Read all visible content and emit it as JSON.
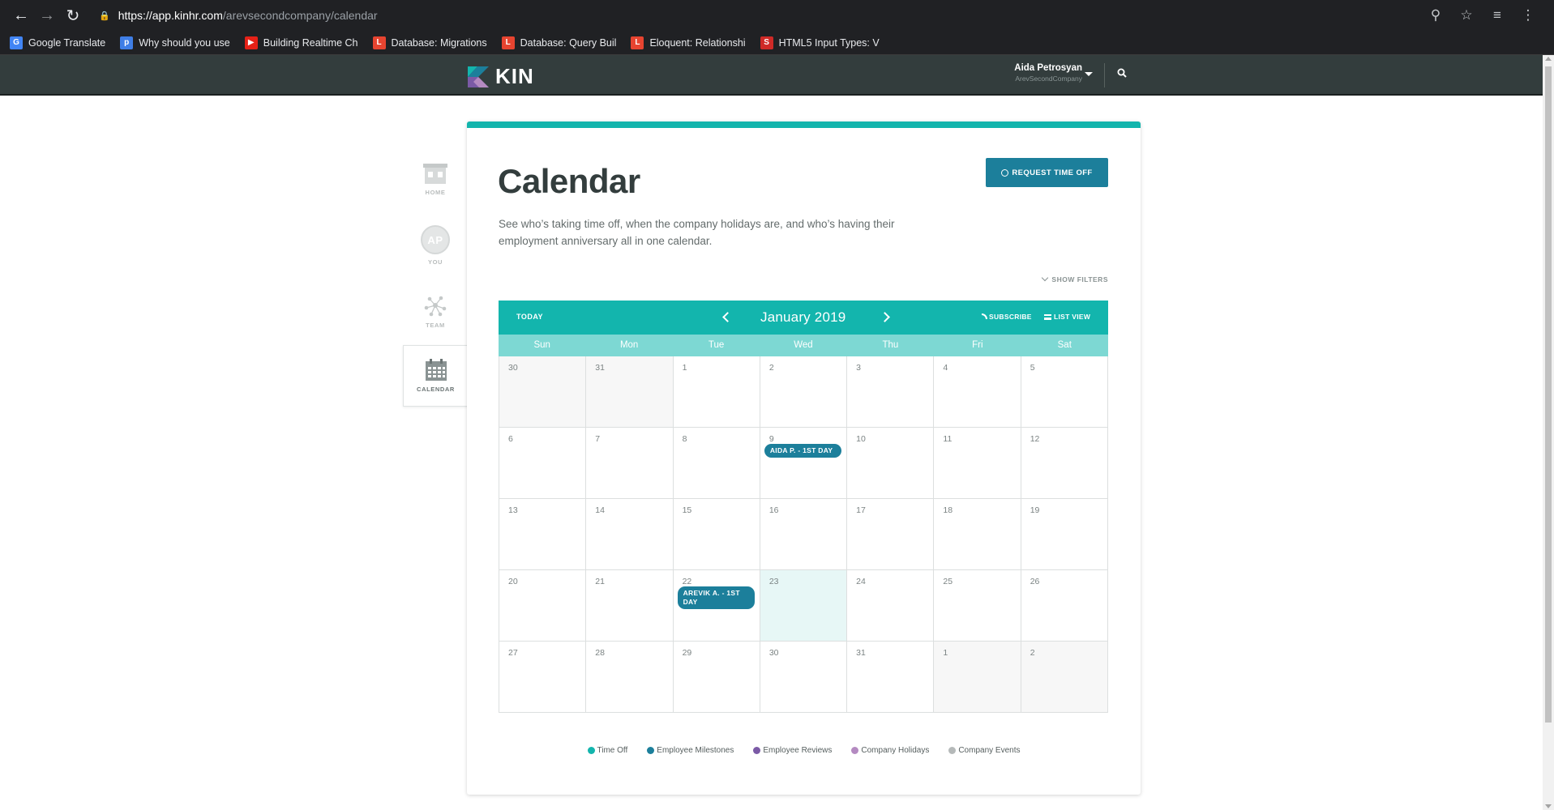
{
  "browser": {
    "url_host": "https://app.kinhr.com",
    "url_path": "/arevsecondcompany/calendar",
    "bookmarks": [
      {
        "label": "Google Translate",
        "icon": "google-translate-icon",
        "color": "#4285f4",
        "glyph": "G"
      },
      {
        "label": "Why should you use",
        "icon": "p-icon",
        "color": "#3f7ee6",
        "glyph": "p"
      },
      {
        "label": "Building Realtime Ch",
        "icon": "youtube-icon",
        "color": "#e62117",
        "glyph": "▶"
      },
      {
        "label": "Database: Migrations",
        "icon": "laravel-icon",
        "color": "#e74430",
        "glyph": "L"
      },
      {
        "label": "Database: Query Buil",
        "icon": "laravel-icon",
        "color": "#e74430",
        "glyph": "L"
      },
      {
        "label": "Eloquent: Relationshi",
        "icon": "laravel-icon",
        "color": "#e74430",
        "glyph": "L"
      },
      {
        "label": "HTML5 Input Types: V",
        "icon": "s-icon",
        "color": "#cf2a27",
        "glyph": "S"
      }
    ]
  },
  "header": {
    "logo_text": "KIN",
    "user_name": "Aida Petrosyan",
    "user_company": "ArevSecondCompany"
  },
  "sidenav": {
    "items": [
      {
        "label": "HOME",
        "icon": "building-icon"
      },
      {
        "label": "YOU",
        "icon": "avatar-icon",
        "initials": "AP"
      },
      {
        "label": "TEAM",
        "icon": "team-network-icon"
      },
      {
        "label": "CALENDAR",
        "icon": "calendar-icon",
        "active": true
      }
    ]
  },
  "page": {
    "title": "Calendar",
    "description": "See who’s taking time off, when the company holidays are, and who’s having their employment anniversary all in one calendar.",
    "request_button": "REQUEST TIME OFF",
    "show_filters": "SHOW FILTERS"
  },
  "calendar": {
    "today_label": "TODAY",
    "month_label": "January 2019",
    "subscribe_label": "SUBSCRIBE",
    "list_view_label": "LIST VIEW",
    "weekdays": [
      "Sun",
      "Mon",
      "Tue",
      "Wed",
      "Thu",
      "Fri",
      "Sat"
    ],
    "weeks": [
      [
        {
          "d": "30",
          "o": true
        },
        {
          "d": "31",
          "o": true
        },
        {
          "d": "1"
        },
        {
          "d": "2"
        },
        {
          "d": "3"
        },
        {
          "d": "4"
        },
        {
          "d": "5"
        }
      ],
      [
        {
          "d": "6"
        },
        {
          "d": "7"
        },
        {
          "d": "8"
        },
        {
          "d": "9",
          "event": "AIDA P. - 1ST DAY"
        },
        {
          "d": "10"
        },
        {
          "d": "11"
        },
        {
          "d": "12"
        }
      ],
      [
        {
          "d": "13"
        },
        {
          "d": "14"
        },
        {
          "d": "15"
        },
        {
          "d": "16"
        },
        {
          "d": "17"
        },
        {
          "d": "18"
        },
        {
          "d": "19"
        }
      ],
      [
        {
          "d": "20"
        },
        {
          "d": "21"
        },
        {
          "d": "22",
          "event": "AREVIK A. - 1ST DAY"
        },
        {
          "d": "23",
          "today": true
        },
        {
          "d": "24"
        },
        {
          "d": "25"
        },
        {
          "d": "26"
        }
      ],
      [
        {
          "d": "27"
        },
        {
          "d": "28"
        },
        {
          "d": "29"
        },
        {
          "d": "30"
        },
        {
          "d": "31"
        },
        {
          "d": "1",
          "o": true
        },
        {
          "d": "2",
          "o": true
        }
      ]
    ]
  },
  "legend": [
    {
      "label": "Time Off",
      "color": "#13b5ad"
    },
    {
      "label": "Employee Milestones",
      "color": "#1c7f9b"
    },
    {
      "label": "Employee Reviews",
      "color": "#7b5aa6"
    },
    {
      "label": "Company Holidays",
      "color": "#b48ac1"
    },
    {
      "label": "Company Events",
      "color": "#b5b9b9"
    }
  ],
  "colors": {
    "accent": "#13b5ad",
    "primary_button": "#1c7f9b",
    "header_bg": "#333d3d"
  }
}
